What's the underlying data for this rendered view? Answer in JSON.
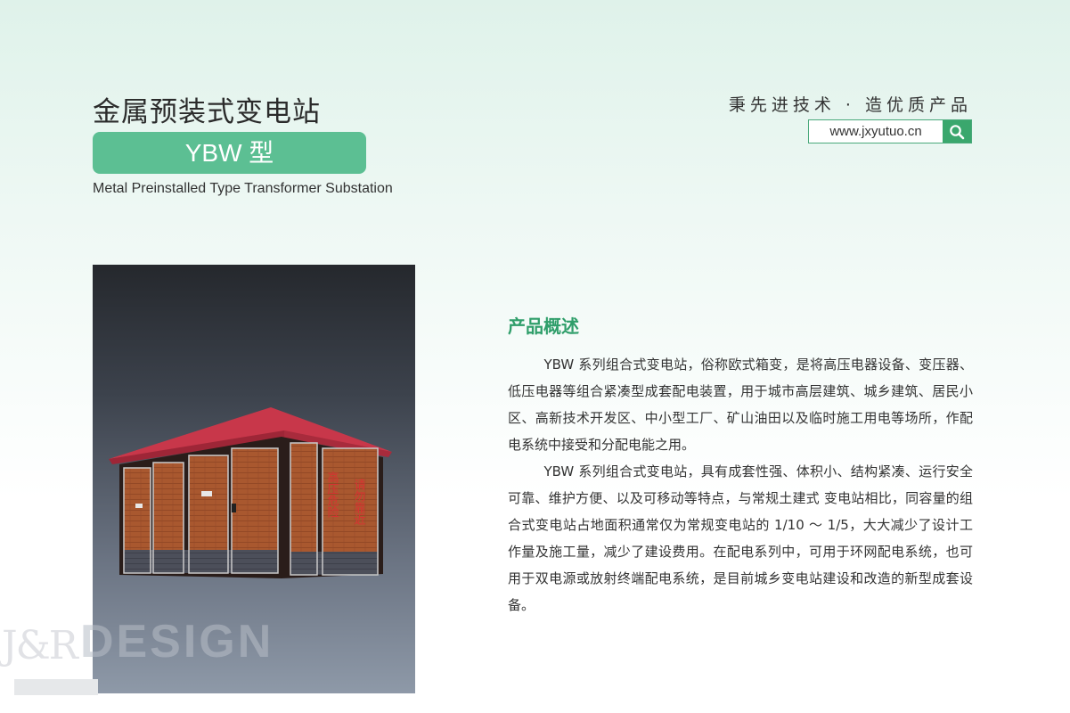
{
  "header": {
    "title_zh": "金属预装式变电站",
    "model": "YBW 型",
    "title_en": "Metal Preinstalled Type Transformer Substation"
  },
  "brand": {
    "slogan": "秉先进技术 · 造优质产品",
    "url": "www.jxyutuo.cn",
    "search_icon": "search-icon"
  },
  "product_image": {
    "warning_left": "高压危险",
    "warning_right": "请勿靠近"
  },
  "overview": {
    "title": "产品概述",
    "paragraphs": [
      "YBW 系列组合式变电站，俗称欧式箱变，是将高压电器设备、变压器、低压电器等组合紧凑型成套配电装置，用于城市高层建筑、城乡建筑、居民小区、高新技术开发区、中小型工厂、矿山油田以及临时施工用电等场所，作配电系统中接受和分配电能之用。",
      "YBW 系列组合式变电站，具有成套性强、体积小、结构紧凑、运行安全可靠、维护方便、以及可移动等特点，与常规土建式 变电站相比，同容量的组合式变电站占地面积通常仅为常规变电站的 1/10 ～ 1/5，大大减少了设计工作量及施工量，减少了建设费用。在配电系列中，可用于环网配电系统，也可用于双电源或放射终端配电系统，是目前城乡变电站建设和改造的新型成套设备。"
    ]
  },
  "watermark": {
    "mark": "J&R",
    "word": "DESIGN"
  },
  "colors": {
    "accent": "#5cbf93",
    "heading": "#2f9e6a",
    "roof": "#c8374a",
    "brick": "#a9582f"
  }
}
